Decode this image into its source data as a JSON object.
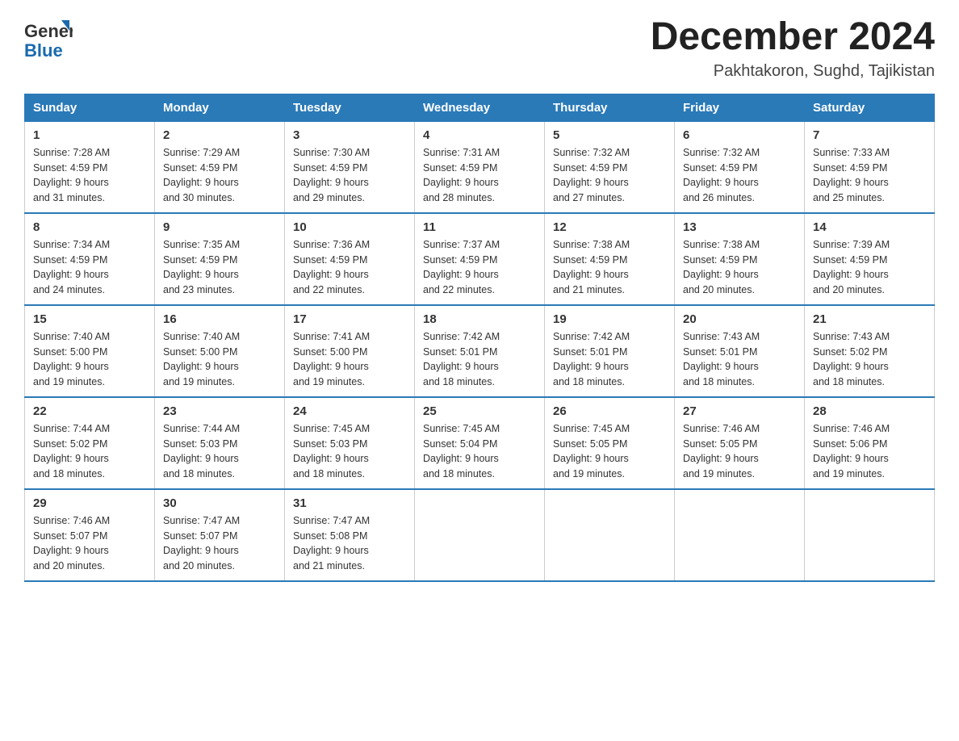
{
  "header": {
    "logo_line1": "General",
    "logo_line2": "Blue",
    "month_title": "December 2024",
    "location": "Pakhtakoron, Sughd, Tajikistan"
  },
  "weekdays": [
    "Sunday",
    "Monday",
    "Tuesday",
    "Wednesday",
    "Thursday",
    "Friday",
    "Saturday"
  ],
  "weeks": [
    [
      {
        "day": "1",
        "sunrise": "7:28 AM",
        "sunset": "4:59 PM",
        "daylight": "9 hours and 31 minutes."
      },
      {
        "day": "2",
        "sunrise": "7:29 AM",
        "sunset": "4:59 PM",
        "daylight": "9 hours and 30 minutes."
      },
      {
        "day": "3",
        "sunrise": "7:30 AM",
        "sunset": "4:59 PM",
        "daylight": "9 hours and 29 minutes."
      },
      {
        "day": "4",
        "sunrise": "7:31 AM",
        "sunset": "4:59 PM",
        "daylight": "9 hours and 28 minutes."
      },
      {
        "day": "5",
        "sunrise": "7:32 AM",
        "sunset": "4:59 PM",
        "daylight": "9 hours and 27 minutes."
      },
      {
        "day": "6",
        "sunrise": "7:32 AM",
        "sunset": "4:59 PM",
        "daylight": "9 hours and 26 minutes."
      },
      {
        "day": "7",
        "sunrise": "7:33 AM",
        "sunset": "4:59 PM",
        "daylight": "9 hours and 25 minutes."
      }
    ],
    [
      {
        "day": "8",
        "sunrise": "7:34 AM",
        "sunset": "4:59 PM",
        "daylight": "9 hours and 24 minutes."
      },
      {
        "day": "9",
        "sunrise": "7:35 AM",
        "sunset": "4:59 PM",
        "daylight": "9 hours and 23 minutes."
      },
      {
        "day": "10",
        "sunrise": "7:36 AM",
        "sunset": "4:59 PM",
        "daylight": "9 hours and 22 minutes."
      },
      {
        "day": "11",
        "sunrise": "7:37 AM",
        "sunset": "4:59 PM",
        "daylight": "9 hours and 22 minutes."
      },
      {
        "day": "12",
        "sunrise": "7:38 AM",
        "sunset": "4:59 PM",
        "daylight": "9 hours and 21 minutes."
      },
      {
        "day": "13",
        "sunrise": "7:38 AM",
        "sunset": "4:59 PM",
        "daylight": "9 hours and 20 minutes."
      },
      {
        "day": "14",
        "sunrise": "7:39 AM",
        "sunset": "4:59 PM",
        "daylight": "9 hours and 20 minutes."
      }
    ],
    [
      {
        "day": "15",
        "sunrise": "7:40 AM",
        "sunset": "5:00 PM",
        "daylight": "9 hours and 19 minutes."
      },
      {
        "day": "16",
        "sunrise": "7:40 AM",
        "sunset": "5:00 PM",
        "daylight": "9 hours and 19 minutes."
      },
      {
        "day": "17",
        "sunrise": "7:41 AM",
        "sunset": "5:00 PM",
        "daylight": "9 hours and 19 minutes."
      },
      {
        "day": "18",
        "sunrise": "7:42 AM",
        "sunset": "5:01 PM",
        "daylight": "9 hours and 18 minutes."
      },
      {
        "day": "19",
        "sunrise": "7:42 AM",
        "sunset": "5:01 PM",
        "daylight": "9 hours and 18 minutes."
      },
      {
        "day": "20",
        "sunrise": "7:43 AM",
        "sunset": "5:01 PM",
        "daylight": "9 hours and 18 minutes."
      },
      {
        "day": "21",
        "sunrise": "7:43 AM",
        "sunset": "5:02 PM",
        "daylight": "9 hours and 18 minutes."
      }
    ],
    [
      {
        "day": "22",
        "sunrise": "7:44 AM",
        "sunset": "5:02 PM",
        "daylight": "9 hours and 18 minutes."
      },
      {
        "day": "23",
        "sunrise": "7:44 AM",
        "sunset": "5:03 PM",
        "daylight": "9 hours and 18 minutes."
      },
      {
        "day": "24",
        "sunrise": "7:45 AM",
        "sunset": "5:03 PM",
        "daylight": "9 hours and 18 minutes."
      },
      {
        "day": "25",
        "sunrise": "7:45 AM",
        "sunset": "5:04 PM",
        "daylight": "9 hours and 18 minutes."
      },
      {
        "day": "26",
        "sunrise": "7:45 AM",
        "sunset": "5:05 PM",
        "daylight": "9 hours and 19 minutes."
      },
      {
        "day": "27",
        "sunrise": "7:46 AM",
        "sunset": "5:05 PM",
        "daylight": "9 hours and 19 minutes."
      },
      {
        "day": "28",
        "sunrise": "7:46 AM",
        "sunset": "5:06 PM",
        "daylight": "9 hours and 19 minutes."
      }
    ],
    [
      {
        "day": "29",
        "sunrise": "7:46 AM",
        "sunset": "5:07 PM",
        "daylight": "9 hours and 20 minutes."
      },
      {
        "day": "30",
        "sunrise": "7:47 AM",
        "sunset": "5:07 PM",
        "daylight": "9 hours and 20 minutes."
      },
      {
        "day": "31",
        "sunrise": "7:47 AM",
        "sunset": "5:08 PM",
        "daylight": "9 hours and 21 minutes."
      },
      null,
      null,
      null,
      null
    ]
  ],
  "labels": {
    "sunrise": "Sunrise:",
    "sunset": "Sunset:",
    "daylight": "Daylight:"
  }
}
